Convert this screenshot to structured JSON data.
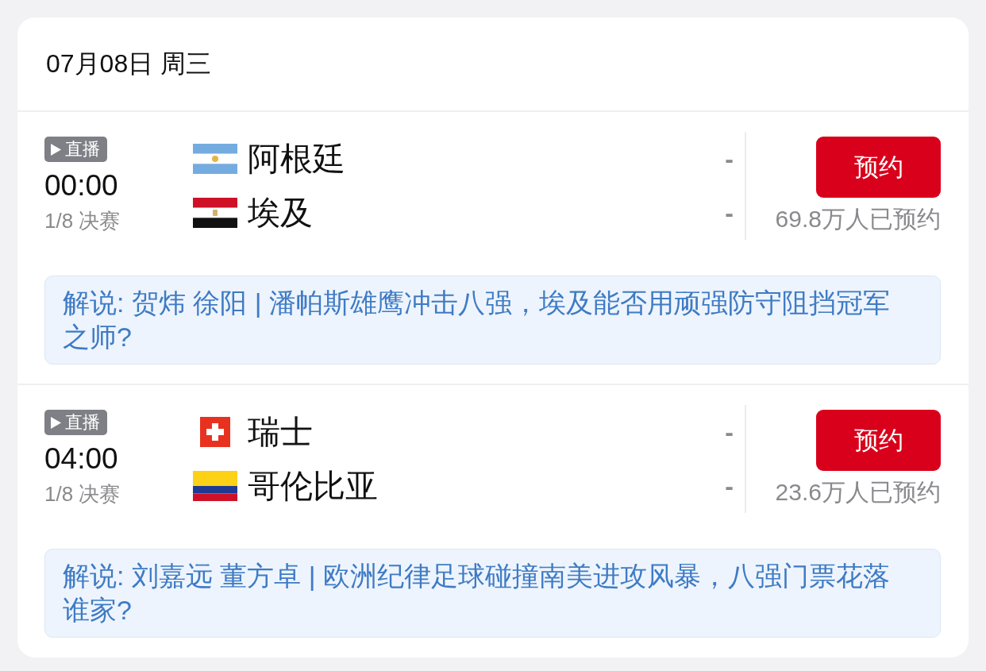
{
  "date_header": {
    "text": "07月08日 周三"
  },
  "matches": [
    {
      "live_badge": "直播",
      "time": "00:00",
      "round": "1/8 决赛",
      "teams": [
        {
          "name": "阿根廷",
          "kind": "argentina",
          "score": "-"
        },
        {
          "name": "埃及",
          "kind": "egypt",
          "score": "-"
        }
      ],
      "reserve_button": "预约",
      "reservations": "69.8万人已预约",
      "commentary": "解说: 贺炜 徐阳 | 潘帕斯雄鹰冲击八强，埃及能否用顽强防守阻挡冠军之师?"
    },
    {
      "live_badge": "直播",
      "time": "04:00",
      "round": "1/8 决赛",
      "teams": [
        {
          "name": "瑞士",
          "kind": "switzerland",
          "score": "-"
        },
        {
          "name": "哥伦比亚",
          "kind": "colombia",
          "score": "-"
        }
      ],
      "reserve_button": "预约",
      "reservations": "23.6万人已预约",
      "commentary": "解说: 刘嘉远 董方卓 | 欧洲纪律足球碰撞南美进攻风暴，八强门票花落谁家?"
    }
  ]
}
